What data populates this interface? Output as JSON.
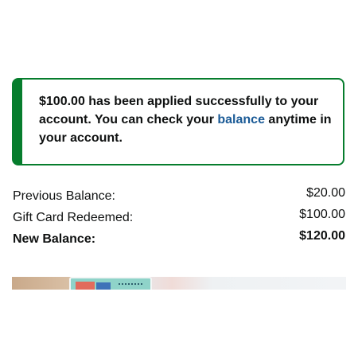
{
  "alert": {
    "text_before": "$100.00 has been applied successfully to your account. You can check your ",
    "link_text": "balance",
    "text_after": " anytime in your account.",
    "accent_color": "#067d2d",
    "link_color": "#1a5a96"
  },
  "balances": {
    "previous_label": "Previous Balance:",
    "previous_value": "$20.00",
    "redeemed_label": "Gift Card Redeemed:",
    "redeemed_value": "$100.00",
    "new_label": "New Balance:",
    "new_value": "$120.00"
  },
  "promo": {
    "image_icon": "gift-card-promo-image"
  }
}
